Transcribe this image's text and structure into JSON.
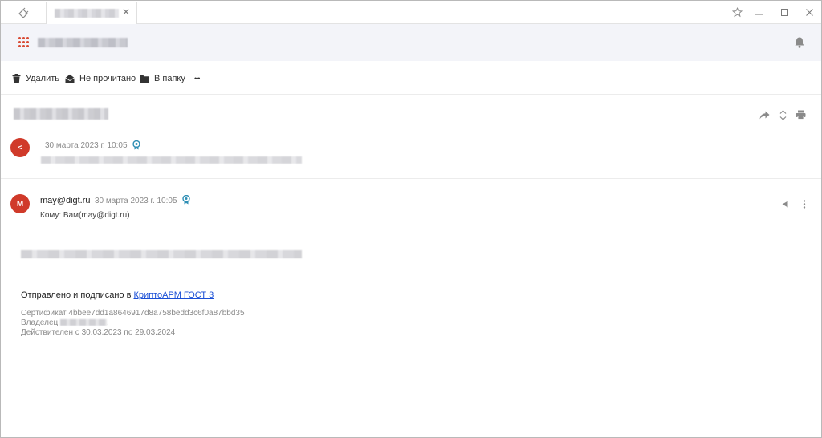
{
  "titlebar": {
    "tab_close": "✕",
    "icons": [
      "app-logo-icon",
      "tab-close-icon",
      "star-icon",
      "minimize-icon",
      "maximize-icon",
      "close-icon"
    ]
  },
  "header": {
    "icons": [
      "apps-grid-icon",
      "bell-icon"
    ],
    "accent_color": "#d84b35",
    "background": "#f3f4f9"
  },
  "toolbar": {
    "delete_label": "Удалить",
    "unread_label": "Не прочитано",
    "folder_label": "В папку",
    "more_label": "•••"
  },
  "thread": {
    "icons": [
      "forward-icon",
      "expand-collapse-icon",
      "print-icon"
    ],
    "collapsed_message": {
      "avatar_letter": "<",
      "date": "30 марта 2023 г. 10:05",
      "avatar_color": "#d03a2a"
    },
    "message": {
      "avatar_letter": "M",
      "sender": "may@digt.ru",
      "date": "30 марта 2023 г. 10:05",
      "recipient": "Кому: Вам(may@digt.ru)",
      "signed_text": "Отправлено и подписано в ",
      "signed_link": "КриптоАРМ ГОСТ 3",
      "certificate": "Сертификат 4bbee7dd1a8646917d8a758bedd3c6f0a87bbd35",
      "owner_label": "Владелец ",
      "owner_suffix": ",",
      "validity": "Действителен с 30.03.2023 по 29.03.2024",
      "link_color": "#1a4fd6"
    }
  }
}
